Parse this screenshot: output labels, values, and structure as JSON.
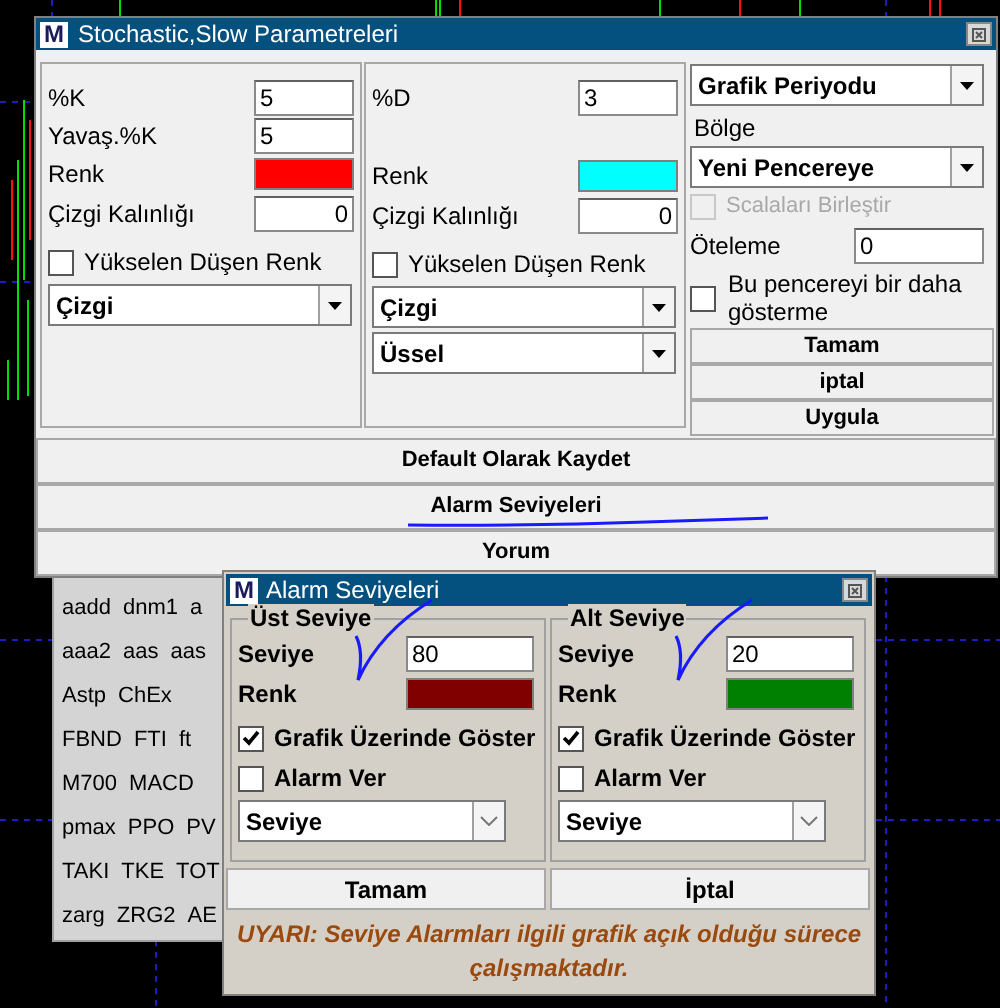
{
  "main_dialog": {
    "logo": "M",
    "title": "Stochastic,Slow Parametreleri",
    "left_panel": {
      "fields": [
        {
          "label": "%K",
          "value": "5"
        },
        {
          "label": "Yavaş.%K",
          "value": "5"
        }
      ],
      "color_label": "Renk",
      "color": "#ff0000",
      "thickness": {
        "label": "Çizgi Kalınlığı",
        "value": "0"
      },
      "rising_falling": {
        "label": "Yükselen Düşen Renk",
        "checked": false
      },
      "dropdowns": [
        "Çizgi"
      ]
    },
    "middle_panel": {
      "fields": [
        {
          "label": "%D",
          "value": "3"
        }
      ],
      "color_label": "Renk",
      "color": "#00ffff",
      "thickness": {
        "label": "Çizgi Kalınlığı",
        "value": "0"
      },
      "rising_falling": {
        "label": "Yükselen Düşen Renk",
        "checked": false
      },
      "dropdowns": [
        "Çizgi",
        "Üssel"
      ]
    },
    "right_panel": {
      "period_dropdown": "Grafik Periyodu",
      "region_label": "Bölge",
      "region_dropdown": "Yeni Pencereye",
      "merge_scales": {
        "label": "Scalaları Birleştir",
        "checked": false,
        "disabled": true
      },
      "offset": {
        "label": "Öteleme",
        "value": "0"
      },
      "dont_show": {
        "label": "Bu pencereyi bir daha gösterme",
        "checked": false
      },
      "buttons": [
        "Tamam",
        "iptal",
        "Uygula"
      ]
    },
    "bottom_buttons": [
      {
        "label": "Default Olarak Kaydet",
        "annotated": false
      },
      {
        "label": "Alarm Seviyeleri",
        "annotated": true
      },
      {
        "label": "Yorum",
        "annotated": false
      }
    ]
  },
  "indicator_list": {
    "rows": [
      [
        "aadd",
        "dnm1",
        "a"
      ],
      [
        "aaa2",
        "aas",
        "aas"
      ],
      [
        "Astp",
        "ChEx"
      ],
      [
        "FBND",
        "FTI",
        "ft"
      ],
      [
        "M700",
        "MACD"
      ],
      [
        "pmax",
        "PPO",
        "PV"
      ],
      [
        "TAKI",
        "TKE",
        "TOT"
      ],
      [
        "zarg",
        "ZRG2",
        "AE"
      ]
    ]
  },
  "alarm_dialog": {
    "logo": "M",
    "title": "Alarm Seviyeleri",
    "groups": [
      {
        "title": "Üst Seviye",
        "level_label": "Seviye",
        "level_value": "80",
        "color_label": "Renk",
        "color": "#800000",
        "show_on_chart": {
          "label": "Grafik Üzerinde Göster",
          "checked": true
        },
        "alarm": {
          "label": "Alarm Ver",
          "checked": false
        },
        "dropdown": "Seviye",
        "annotated": true
      },
      {
        "title": "Alt Seviye",
        "level_label": "Seviye",
        "level_value": "20",
        "color_label": "Renk",
        "color": "#008000",
        "show_on_chart": {
          "label": "Grafik Üzerinde Göster",
          "checked": true
        },
        "alarm": {
          "label": "Alarm Ver",
          "checked": false
        },
        "dropdown": "Seviye",
        "annotated": true
      }
    ],
    "buttons": [
      "Tamam",
      "İptal"
    ],
    "warning": "UYARI:  Seviye Alarmları ilgili grafik açık olduğu sürece çalışmaktadır."
  }
}
